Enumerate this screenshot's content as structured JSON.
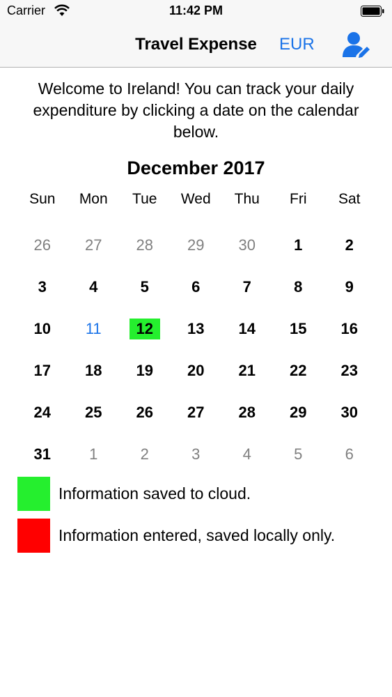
{
  "status_bar": {
    "carrier": "Carrier",
    "time": "11:42 PM"
  },
  "nav": {
    "title": "Travel Expense",
    "currency": "EUR",
    "profile_icon": "user-edit-icon"
  },
  "welcome_text": "Welcome to Ireland! You can track your daily expenditure by clicking a date on the calendar below.",
  "calendar": {
    "month_title": "December 2017",
    "weekdays": [
      "Sun",
      "Mon",
      "Tue",
      "Wed",
      "Thu",
      "Fri",
      "Sat"
    ],
    "weeks": [
      [
        {
          "d": "26",
          "state": "other-month"
        },
        {
          "d": "27",
          "state": "other-month"
        },
        {
          "d": "28",
          "state": "other-month"
        },
        {
          "d": "29",
          "state": "other-month"
        },
        {
          "d": "30",
          "state": "other-month"
        },
        {
          "d": "1",
          "state": "normal"
        },
        {
          "d": "2",
          "state": "normal"
        }
      ],
      [
        {
          "d": "3",
          "state": "normal"
        },
        {
          "d": "4",
          "state": "normal"
        },
        {
          "d": "5",
          "state": "normal"
        },
        {
          "d": "6",
          "state": "normal"
        },
        {
          "d": "7",
          "state": "normal"
        },
        {
          "d": "8",
          "state": "normal"
        },
        {
          "d": "9",
          "state": "normal"
        }
      ],
      [
        {
          "d": "10",
          "state": "normal"
        },
        {
          "d": "11",
          "state": "today"
        },
        {
          "d": "12",
          "state": "saved-cloud"
        },
        {
          "d": "13",
          "state": "normal"
        },
        {
          "d": "14",
          "state": "normal"
        },
        {
          "d": "15",
          "state": "normal"
        },
        {
          "d": "16",
          "state": "normal"
        }
      ],
      [
        {
          "d": "17",
          "state": "normal"
        },
        {
          "d": "18",
          "state": "normal"
        },
        {
          "d": "19",
          "state": "normal"
        },
        {
          "d": "20",
          "state": "normal"
        },
        {
          "d": "21",
          "state": "normal"
        },
        {
          "d": "22",
          "state": "normal"
        },
        {
          "d": "23",
          "state": "normal"
        }
      ],
      [
        {
          "d": "24",
          "state": "normal"
        },
        {
          "d": "25",
          "state": "normal"
        },
        {
          "d": "26",
          "state": "normal"
        },
        {
          "d": "27",
          "state": "normal"
        },
        {
          "d": "28",
          "state": "normal"
        },
        {
          "d": "29",
          "state": "normal"
        },
        {
          "d": "30",
          "state": "normal"
        }
      ],
      [
        {
          "d": "31",
          "state": "normal"
        },
        {
          "d": "1",
          "state": "other-month"
        },
        {
          "d": "2",
          "state": "other-month"
        },
        {
          "d": "3",
          "state": "other-month"
        },
        {
          "d": "4",
          "state": "other-month"
        },
        {
          "d": "5",
          "state": "other-month"
        },
        {
          "d": "6",
          "state": "other-month"
        }
      ]
    ]
  },
  "legend": [
    {
      "color": "#25ef2e",
      "label": "Information saved to cloud."
    },
    {
      "color": "#ff0000",
      "label": "Information entered, saved locally only."
    }
  ],
  "colors": {
    "accent": "#1a73e8",
    "saved_cloud": "#25ef2e",
    "saved_local": "#ff0000",
    "muted": "#808080"
  }
}
